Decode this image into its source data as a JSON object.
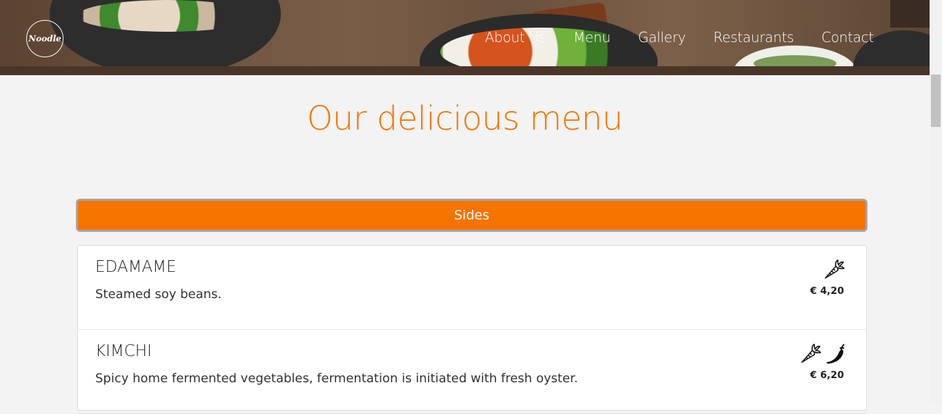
{
  "header": {
    "logo_text": "Noodle",
    "nav": [
      "About Us",
      "Menu",
      "Gallery",
      "Restaurants",
      "Contact"
    ]
  },
  "main": {
    "title": "Our delicious menu",
    "category_button": "Sides",
    "items": [
      {
        "name": "EDAMAME",
        "description": "Steamed soy beans.",
        "price": "€ 4,20",
        "icons": [
          "carrot-icon"
        ]
      },
      {
        "name": "KIMCHI",
        "description": "Spicy home fermented vegetables, fermentation is initiated with fresh oyster.",
        "price": "€ 6,20",
        "icons": [
          "carrot-icon",
          "chili-icon"
        ]
      }
    ]
  },
  "colors": {
    "accent": "#f77300",
    "title": "#f57500",
    "background": "#f3f3f3"
  }
}
